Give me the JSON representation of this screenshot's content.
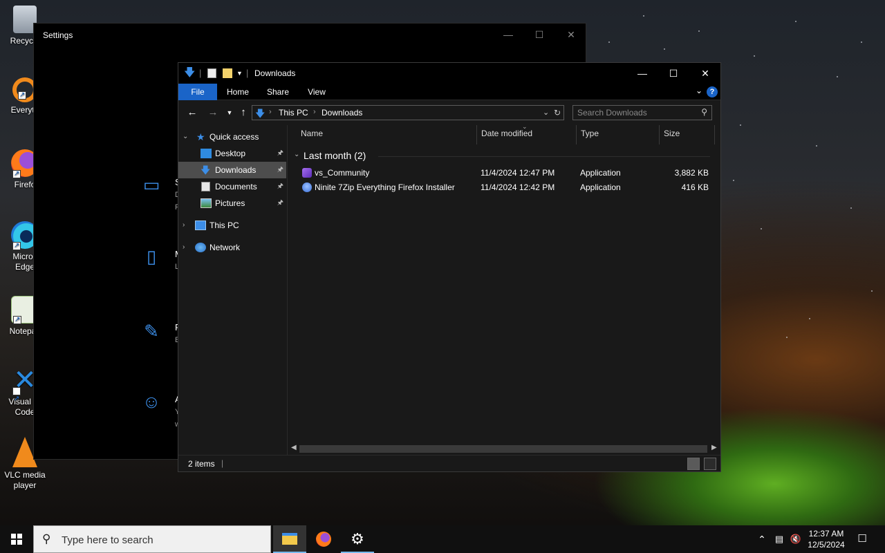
{
  "desktop": {
    "icons": [
      {
        "label": "Recycle",
        "icon": "recycle-bin-icon"
      },
      {
        "label": "Everyth",
        "icon": "everything-search-icon"
      },
      {
        "label": "Firefo",
        "icon": "firefox-icon"
      },
      {
        "label": "Micros",
        "label2": "Edge",
        "icon": "edge-icon"
      },
      {
        "label": "Notepac",
        "icon": "notepad-plus-icon"
      },
      {
        "label": "Visual St",
        "label2": "Code",
        "icon": "vscode-icon"
      },
      {
        "label": "VLC media",
        "label2": "player",
        "icon": "vlc-icon"
      }
    ]
  },
  "settings": {
    "title": "Settings",
    "categories": [
      {
        "icon": "laptop-icon",
        "initial": "S",
        "sub": "D",
        "sub2": "F"
      },
      {
        "icon": "phone-icon",
        "initial": "M",
        "sub": "L"
      },
      {
        "icon": "pen-tablet-icon",
        "initial": "P",
        "sub": "E"
      },
      {
        "icon": "person-icon",
        "initial": "A",
        "sub": "Y",
        "sub2": "w"
      }
    ]
  },
  "explorer": {
    "title": "Downloads",
    "ribbon_tabs": [
      "File",
      "Home",
      "Share",
      "View"
    ],
    "help": "?",
    "address": {
      "crumbs": [
        "This PC",
        "Downloads"
      ]
    },
    "search_placeholder": "Search Downloads",
    "nav": {
      "quick_access": "Quick access",
      "items": [
        {
          "label": "Desktop",
          "icon": "desktop-folder-icon",
          "pinned": true
        },
        {
          "label": "Downloads",
          "icon": "downloads-folder-icon",
          "pinned": true,
          "selected": true
        },
        {
          "label": "Documents",
          "icon": "documents-folder-icon",
          "pinned": true
        },
        {
          "label": "Pictures",
          "icon": "pictures-folder-icon",
          "pinned": true
        }
      ],
      "this_pc": "This PC",
      "network": "Network"
    },
    "columns": [
      "Name",
      "Date modified",
      "Type",
      "Size"
    ],
    "group": "Last month (2)",
    "files": [
      {
        "name": "vs_Community",
        "date": "11/4/2024 12:47 PM",
        "type": "Application",
        "size": "3,882 KB",
        "icon": "visual-studio-icon",
        "color": "#8a5cd6"
      },
      {
        "name": "Ninite 7Zip Everything Firefox Installer",
        "date": "11/4/2024 12:42 PM",
        "type": "Application",
        "size": "416 KB",
        "icon": "ninite-icon",
        "color": "#3a6fd8"
      }
    ],
    "status": {
      "count": "2 items"
    }
  },
  "taskbar": {
    "search_placeholder": "Type here to search",
    "time": "12:37 AM",
    "date": "12/5/2024",
    "apps": [
      "file-explorer-icon",
      "firefox-icon",
      "settings-gear-icon"
    ]
  },
  "colors": {
    "accent": "#1a64c8",
    "selection": "#4d4d4d",
    "icon_blue": "#3c8ee8"
  }
}
